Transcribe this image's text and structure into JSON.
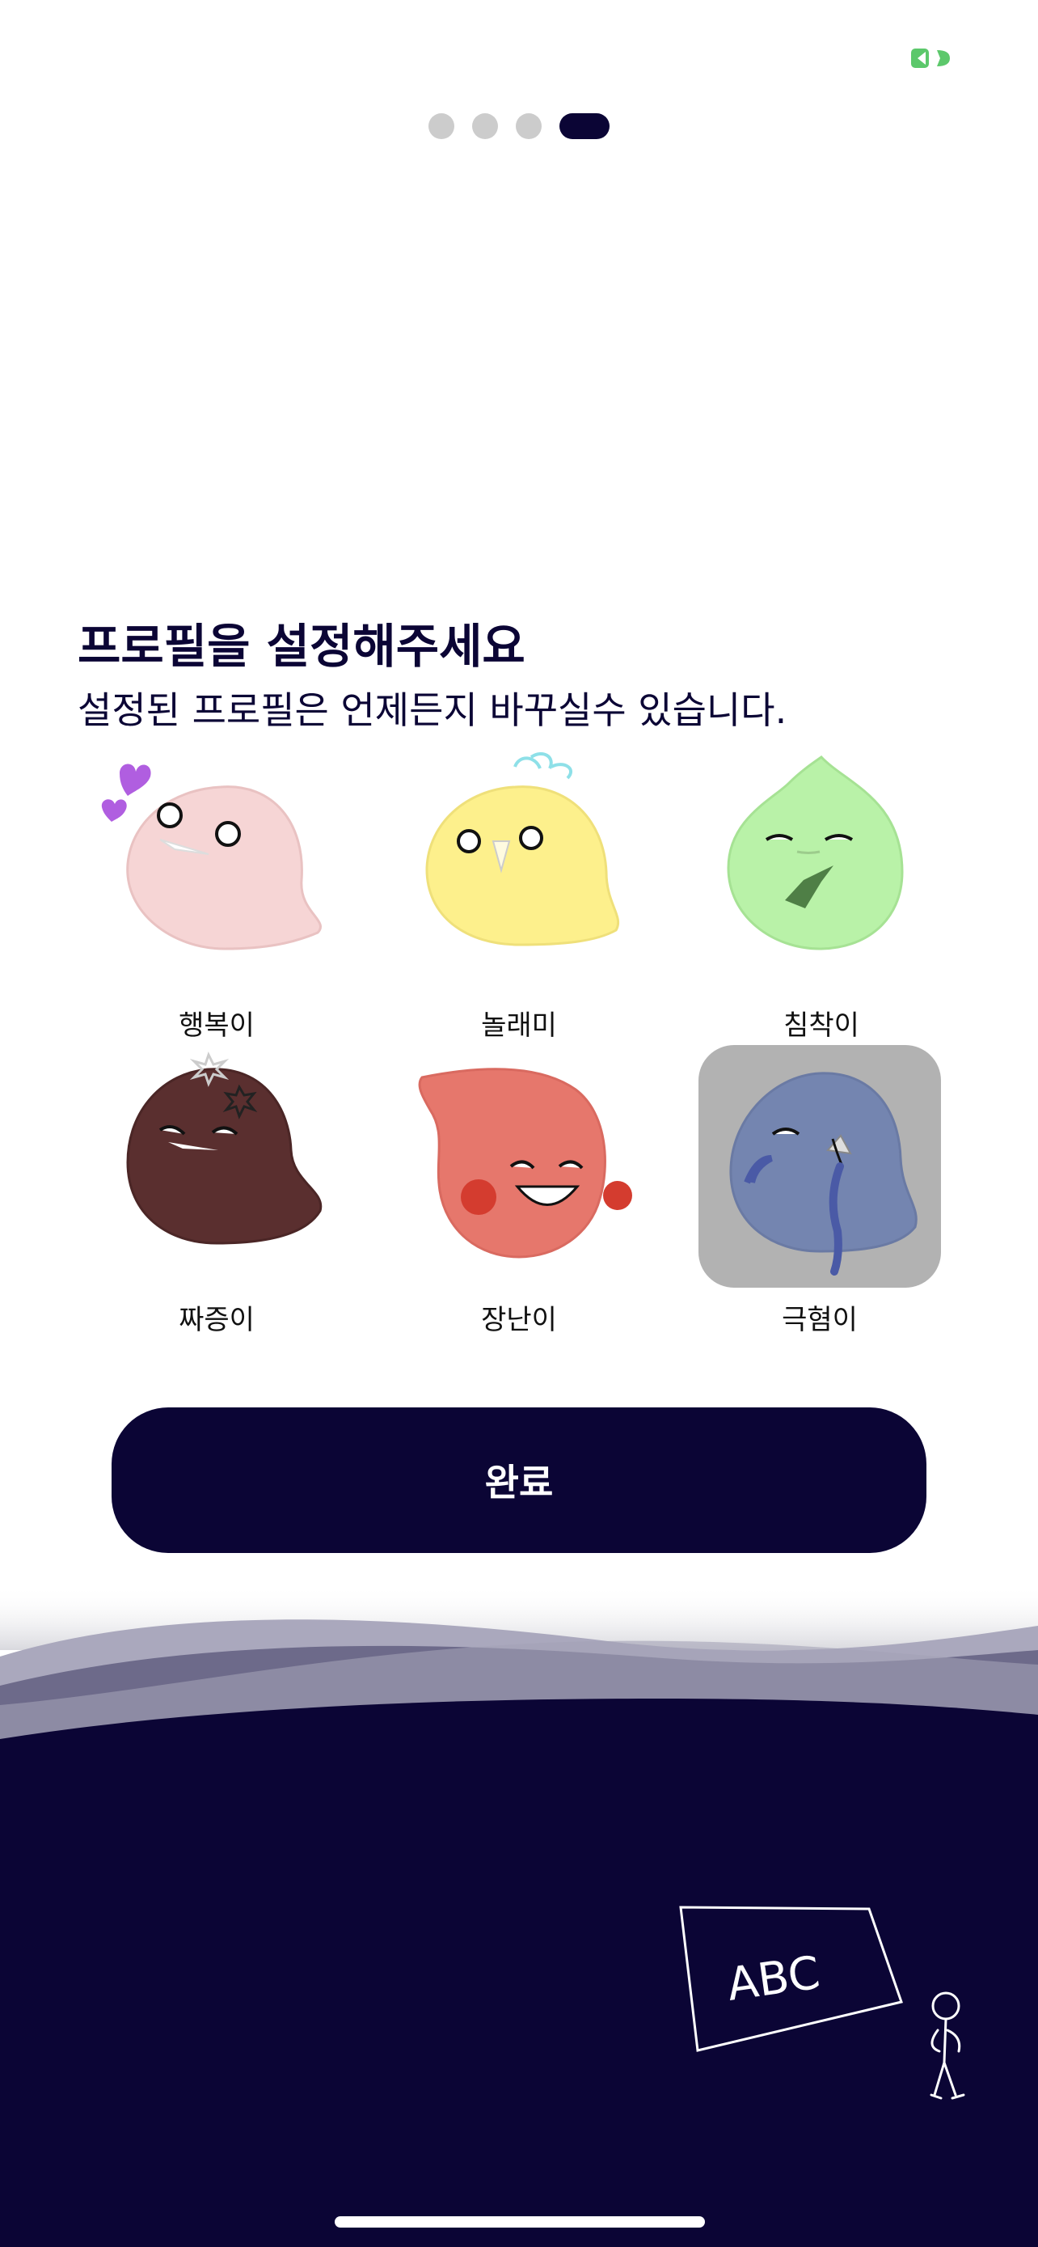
{
  "onboarding": {
    "page_count": 4,
    "current_page": 4
  },
  "header": {
    "title": "프로필을 설정해주세요",
    "subtitle": "설정된 프로필은 언제든지 바꾸실수 있습니다."
  },
  "profiles": [
    {
      "name": "행복이",
      "color": "#f6d5d5",
      "selected": false
    },
    {
      "name": "놀래미",
      "color": "#fdf08c",
      "selected": false
    },
    {
      "name": "침착이",
      "color": "#b9f2a8",
      "selected": false
    },
    {
      "name": "짜증이",
      "color": "#5a2f2f",
      "selected": false
    },
    {
      "name": "장난이",
      "color": "#e6776c",
      "selected": false
    },
    {
      "name": "극혐이",
      "color": "#7485b0",
      "selected": true
    }
  ],
  "complete_button": {
    "label": "완료"
  },
  "chalkboard": {
    "text": "ABC"
  },
  "colors": {
    "primary": "#0b0535",
    "selected_bg": "#b2b2b2",
    "dot_inactive": "#cccccc",
    "battery": "#5cc86b"
  }
}
